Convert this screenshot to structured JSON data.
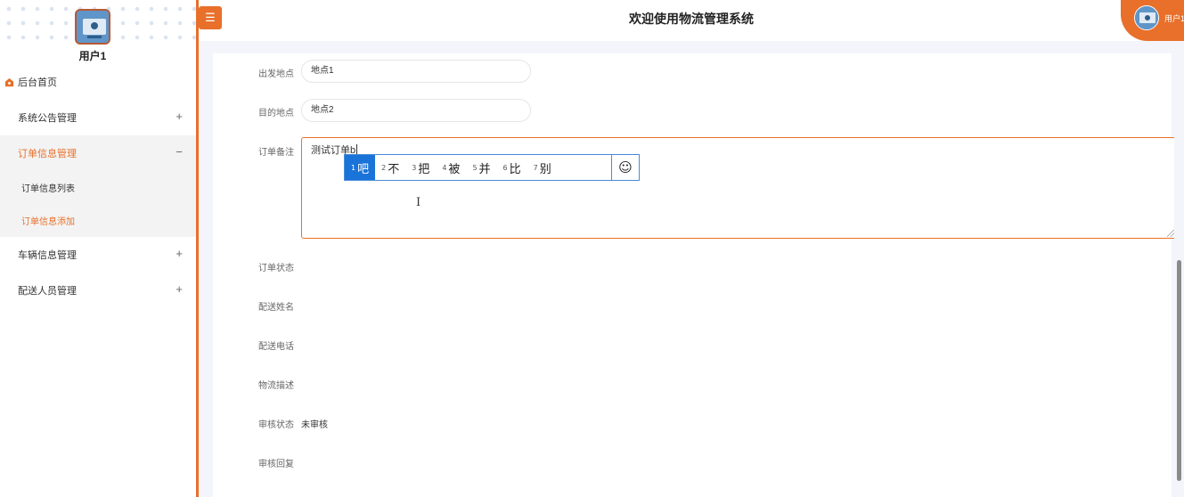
{
  "app": {
    "title": "欢迎使用物流管理系统"
  },
  "user": {
    "name": "用户1",
    "corner_name": "用户1"
  },
  "sidebar": {
    "items": [
      {
        "label": "后台首页",
        "icon": "home-icon",
        "toggle": ""
      },
      {
        "label": "系统公告管理",
        "icon": "grid-icon",
        "toggle": "+"
      },
      {
        "label": "订单信息管理",
        "icon": "grid-icon",
        "toggle": "−",
        "expanded": true,
        "children": [
          {
            "label": "订单信息列表"
          },
          {
            "label": "订单信息添加",
            "active": true
          }
        ]
      },
      {
        "label": "车辆信息管理",
        "icon": "grid-icon",
        "toggle": "+"
      },
      {
        "label": "配送人员管理",
        "icon": "grid-icon",
        "toggle": "+"
      }
    ]
  },
  "header": {
    "menu_icon": "☰"
  },
  "form": {
    "origin_label": "出发地点",
    "origin_value": "地点1",
    "destination_label": "目的地点",
    "destination_value": "地点2",
    "remark_label": "订单备注",
    "remark_value": "测试订单b",
    "status_label": "订单状态",
    "courier_name_label": "配送姓名",
    "courier_phone_label": "配送电话",
    "logistics_desc_label": "物流描述",
    "review_status_label": "审核状态",
    "review_status_value": "未审核",
    "review_reply_label": "审核回复"
  },
  "ime": {
    "candidates": [
      {
        "num": "1",
        "text": "吧"
      },
      {
        "num": "2",
        "text": "不"
      },
      {
        "num": "3",
        "text": "把"
      },
      {
        "num": "4",
        "text": "被"
      },
      {
        "num": "5",
        "text": "并"
      },
      {
        "num": "6",
        "text": "比"
      },
      {
        "num": "7",
        "text": "别"
      }
    ],
    "emoji": "☺"
  },
  "colors": {
    "accent": "#e8702a",
    "ime_select": "#1a73d9"
  }
}
